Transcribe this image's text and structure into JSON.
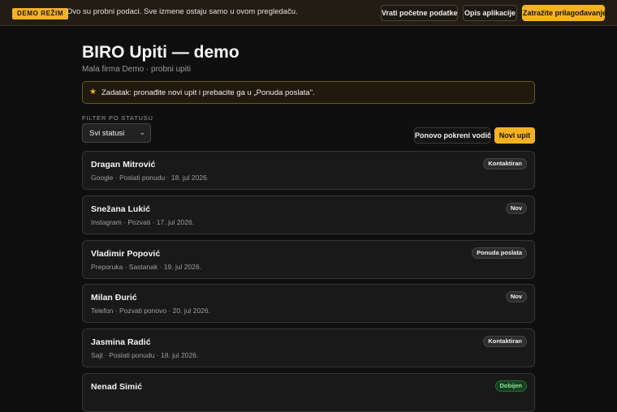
{
  "topbar": {
    "badge": "DEMO REŽIM",
    "message": "Ovo su probni podaci. Sve izmene ostaju samo u ovom pregledaču.",
    "restore_label": "Vrati početne podatke",
    "about_label": "Opis aplikacije",
    "cta_label": "Zatražite prilagođavanje"
  },
  "header": {
    "title": "BIRO Upiti — demo",
    "subtitle": "Mala firma Demo · probni upiti"
  },
  "task": {
    "icon": "star-icon",
    "text": "Zadatak: pronađite novi upit i prebacite ga u „Ponuda poslata\"."
  },
  "filter": {
    "label": "FILTER PO STATUSU",
    "selected": "Svi statusi"
  },
  "actions": {
    "guide_label": "Ponovo pokreni vodič",
    "new_label": "Novi upit"
  },
  "colors": {
    "accent": "#f4b223",
    "background": "#0f0f0f",
    "card": "#191919"
  },
  "inquiries": [
    {
      "name": "Dragan Mitrović",
      "meta": "Google · Poslati ponudu · 18. jul 2026.",
      "status": "Kontaktiran"
    },
    {
      "name": "Snežana Lukić",
      "meta": "Instagram · Pozvati · 17. jul 2026.",
      "status": "Nov"
    },
    {
      "name": "Vladimir Popović",
      "meta": "Preporuka · Sastanak · 19. jul 2026.",
      "status": "Ponuda poslata"
    },
    {
      "name": "Milan Đurić",
      "meta": "Telefon · Pozvati ponovo · 20. jul 2026.",
      "status": "Nov"
    },
    {
      "name": "Jasmina Radić",
      "meta": "Sajt · Poslati ponudu · 18. jul 2026.",
      "status": "Kontaktiran"
    },
    {
      "name": "Nenad Simić",
      "meta": "",
      "status": "Dobijen"
    }
  ]
}
